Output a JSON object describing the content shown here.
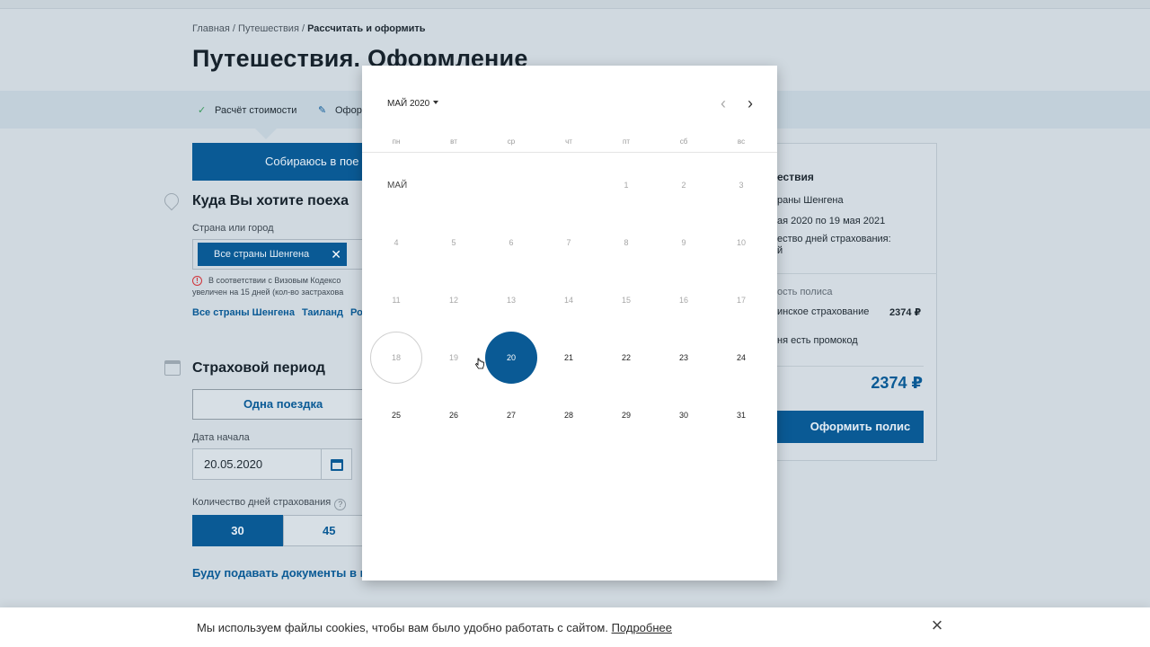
{
  "breadcrumb": {
    "item1": "Главная",
    "sep1": " / ",
    "item2": "Путешествия",
    "sep2": " / ",
    "current": "Рассчитать и оформить"
  },
  "page_title": "Путешествия. Оформление",
  "steps": {
    "step1": "Расчёт стоимости",
    "step2": "Оформ"
  },
  "trip_button": "Собираюсь в пое",
  "destination": {
    "title": "Куда Вы хотите поеха",
    "field_label": "Страна или город",
    "chip": "Все страны Шенгена",
    "warning_line1": "В соответствии с Визовым Кодексо",
    "warning_line2": "увеличен на 15 дней (кол-во застрахова",
    "quick_links": [
      "Все страны Шенгена",
      "Таиланд",
      "Ро"
    ]
  },
  "period": {
    "title": "Страховой период",
    "one_trip": "Одна поездка",
    "start_label": "Дата начала",
    "start_value": "20.05.2020",
    "days_label": "Количество дней страхования",
    "days_options": [
      "30",
      "45"
    ],
    "docs_link": "Буду подавать документы в п"
  },
  "summary": {
    "title": "ествия",
    "country": "раны Шенгена",
    "dates": "ая 2020 по 19 мая 2021",
    "days_line1": "ество дней страхования:",
    "days_line2": "й",
    "cost_label": "ость полиса",
    "medical_label": "инское страхование",
    "medical_price": "2374 ₽",
    "promo": "ня есть промокод",
    "total": "2374 ₽",
    "submit": "Оформить полис"
  },
  "cookie": {
    "text": "Мы используем файлы cookies, чтобы вам было удобно работать с сайтом. ",
    "link": "Подробнее"
  },
  "datepicker": {
    "month_year": "МАЙ 2020",
    "weekdays": [
      "пн",
      "вт",
      "ср",
      "чт",
      "пт",
      "сб",
      "вс"
    ],
    "month_label": "МАЙ",
    "first_weekday_index": 4,
    "days_in_month": 31,
    "today": 18,
    "selected": 20,
    "disabled_until": 19
  },
  "colors": {
    "accent": "#0a5a95",
    "background": "#d0d9e0",
    "disabled_day": "#a7a7a7"
  },
  "icons": {
    "check": "check-icon",
    "edit": "pencil-icon",
    "location": "pin-icon",
    "calendar": "calendar-icon",
    "close": "close-icon",
    "warning": "warning-icon",
    "help": "help-icon",
    "prev": "chevron-left-icon",
    "next": "chevron-right-icon",
    "dropdown": "caret-down-icon",
    "cursor": "hand-cursor-icon"
  }
}
